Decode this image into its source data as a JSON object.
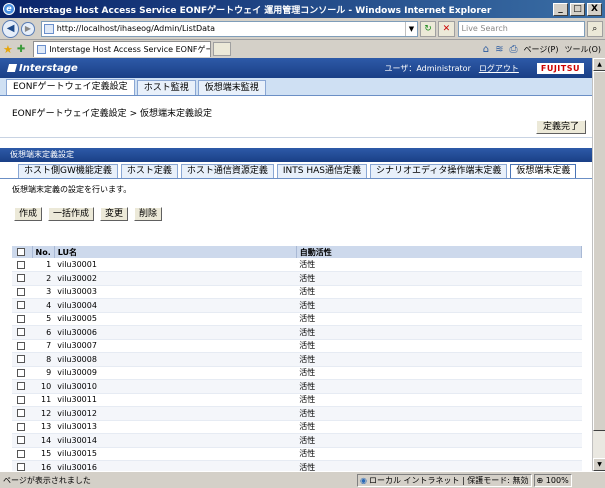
{
  "window": {
    "title": "Interstage Host Access Service EONFゲートウェイ 運用管理コンソール - Windows Internet Explorer",
    "min": "_",
    "max": "□",
    "close": "X"
  },
  "address_bar": {
    "url": "http://localhost/ihaseog/Admin/ListData",
    "search_placeholder": "Live Search"
  },
  "browser_tab": {
    "title": "Interstage Host Access Service EONFゲートウェイ ..."
  },
  "command_bar": {
    "page_label": "ページ(P)",
    "tools_label": "ツール(O)"
  },
  "app": {
    "logo": "Interstage",
    "user_label": "ユーザ：Administrator",
    "logout": "ログアウト",
    "brand": "FUJITSU",
    "nav": [
      {
        "label": "EONFゲートウェイ定義設定"
      },
      {
        "label": "ホスト監視"
      },
      {
        "label": "仮想端末監視"
      }
    ],
    "breadcrumb_parent": "EONFゲートウェイ定義設定",
    "breadcrumb_sep": ">",
    "breadcrumb_current": "仮想端末定義設定",
    "done_button": "定義完了",
    "section_title": "仮想端末定義設定",
    "subtabs": [
      {
        "label": "ホスト側GW機能定義"
      },
      {
        "label": "ホスト定義"
      },
      {
        "label": "ホスト通信資源定義"
      },
      {
        "label": "INTS HAS通信定義"
      },
      {
        "label": "シナリオエディタ操作端末定義"
      },
      {
        "label": "仮想端末定義"
      }
    ],
    "description": "仮想端末定義の設定を行います。",
    "actions": {
      "create": "作成",
      "bulk_create": "一括作成",
      "modify": "変更",
      "delete": "削除"
    }
  },
  "table": {
    "headers": {
      "no": "No.",
      "lu": "LU名",
      "status": "自動活性"
    },
    "rows": [
      {
        "no": "1",
        "lu": "vilu30001",
        "status": "活性"
      },
      {
        "no": "2",
        "lu": "vilu30002",
        "status": "活性"
      },
      {
        "no": "3",
        "lu": "vilu30003",
        "status": "活性"
      },
      {
        "no": "4",
        "lu": "vilu30004",
        "status": "活性"
      },
      {
        "no": "5",
        "lu": "vilu30005",
        "status": "活性"
      },
      {
        "no": "6",
        "lu": "vilu30006",
        "status": "活性"
      },
      {
        "no": "7",
        "lu": "vilu30007",
        "status": "活性"
      },
      {
        "no": "8",
        "lu": "vilu30008",
        "status": "活性"
      },
      {
        "no": "9",
        "lu": "vilu30009",
        "status": "活性"
      },
      {
        "no": "10",
        "lu": "vilu30010",
        "status": "活性"
      },
      {
        "no": "11",
        "lu": "vilu30011",
        "status": "活性"
      },
      {
        "no": "12",
        "lu": "vilu30012",
        "status": "活性"
      },
      {
        "no": "13",
        "lu": "vilu30013",
        "status": "活性"
      },
      {
        "no": "14",
        "lu": "vilu30014",
        "status": "活性"
      },
      {
        "no": "15",
        "lu": "vilu30015",
        "status": "活性"
      },
      {
        "no": "16",
        "lu": "vilu30016",
        "status": "活性"
      }
    ]
  },
  "status_bar": {
    "text": "ページが表示されました",
    "zone": "ローカル イントラネット | 保護モード: 無効",
    "zoom": "100%"
  }
}
